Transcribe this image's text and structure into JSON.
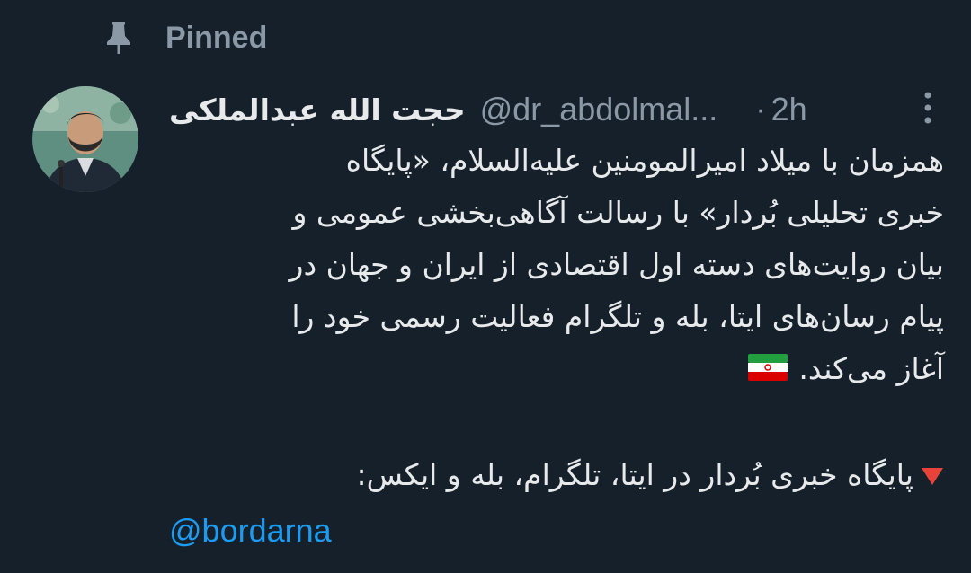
{
  "pinned": {
    "label": "Pinned",
    "icon": "pin-icon"
  },
  "author": {
    "display_name": "حجت الله عبدالملکی",
    "handle": "@dr_abdolmal...",
    "time_separator": "·",
    "time": "2h"
  },
  "tweet": {
    "lines": [
      "همزمان با میلاد امیرالمومنین علیه‌السلام، «پایگاه",
      "خبری تحلیلی بُردار» با رسالت آگاهی‌بخشی عمومی و",
      "بیان روایت‌های دسته اول اقتصادی از ایران و جهان در",
      "پیام رسان‌های ایتا، بله و تلگرام فعالیت رسمی خود را",
      "آغاز می‌کند."
    ],
    "flag_icon": "iran-flag-icon",
    "bullet_icon": "red-triangle-down-icon",
    "bullet_text": "پایگاه خبری بُردار در ایتا، تلگرام، بله و ایکس:",
    "mention": "@bordarna"
  },
  "colors": {
    "background": "#15202b",
    "primary_text": "#e7e9ea",
    "secondary_text": "#8b98a5",
    "link": "#1d9bf0"
  }
}
